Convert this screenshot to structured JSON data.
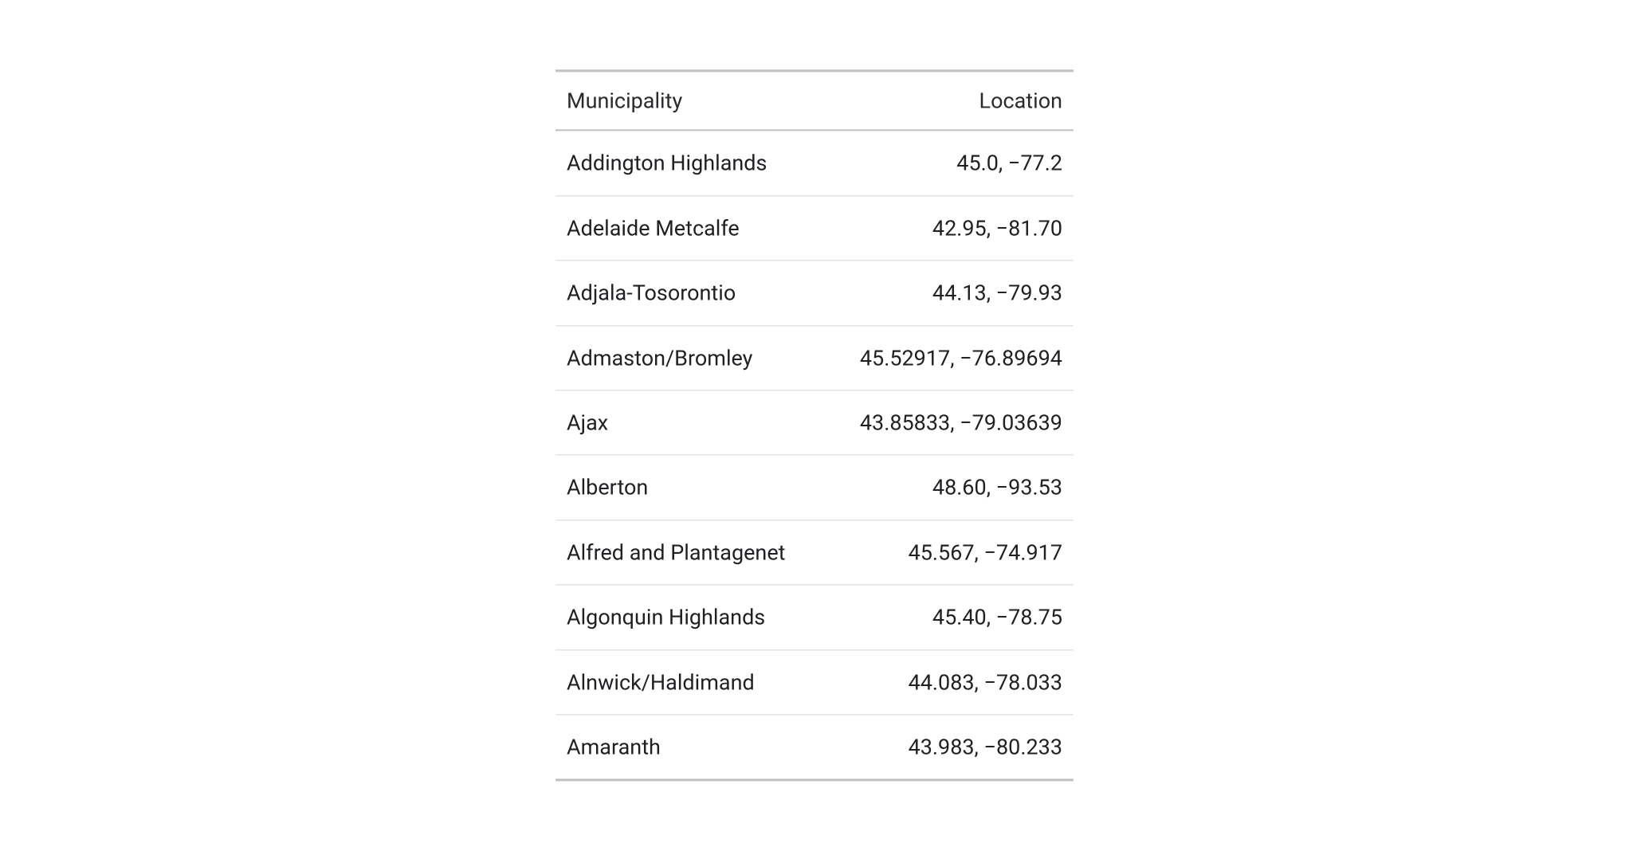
{
  "table": {
    "headers": {
      "municipality": "Municipality",
      "location": "Location"
    },
    "rows": [
      {
        "municipality": "Addington Highlands",
        "location": "45.0, −77.2"
      },
      {
        "municipality": "Adelaide Metcalfe",
        "location": "42.95, −81.70"
      },
      {
        "municipality": "Adjala-Tosorontio",
        "location": "44.13, −79.93"
      },
      {
        "municipality": "Admaston/Bromley",
        "location": "45.52917, −76.89694"
      },
      {
        "municipality": "Ajax",
        "location": "43.85833, −79.03639"
      },
      {
        "municipality": "Alberton",
        "location": "48.60, −93.53"
      },
      {
        "municipality": "Alfred and Plantagenet",
        "location": "45.567, −74.917"
      },
      {
        "municipality": "Algonquin Highlands",
        "location": "45.40, −78.75"
      },
      {
        "municipality": "Alnwick/Haldimand",
        "location": "44.083, −78.033"
      },
      {
        "municipality": "Amaranth",
        "location": "43.983, −80.233"
      }
    ]
  }
}
